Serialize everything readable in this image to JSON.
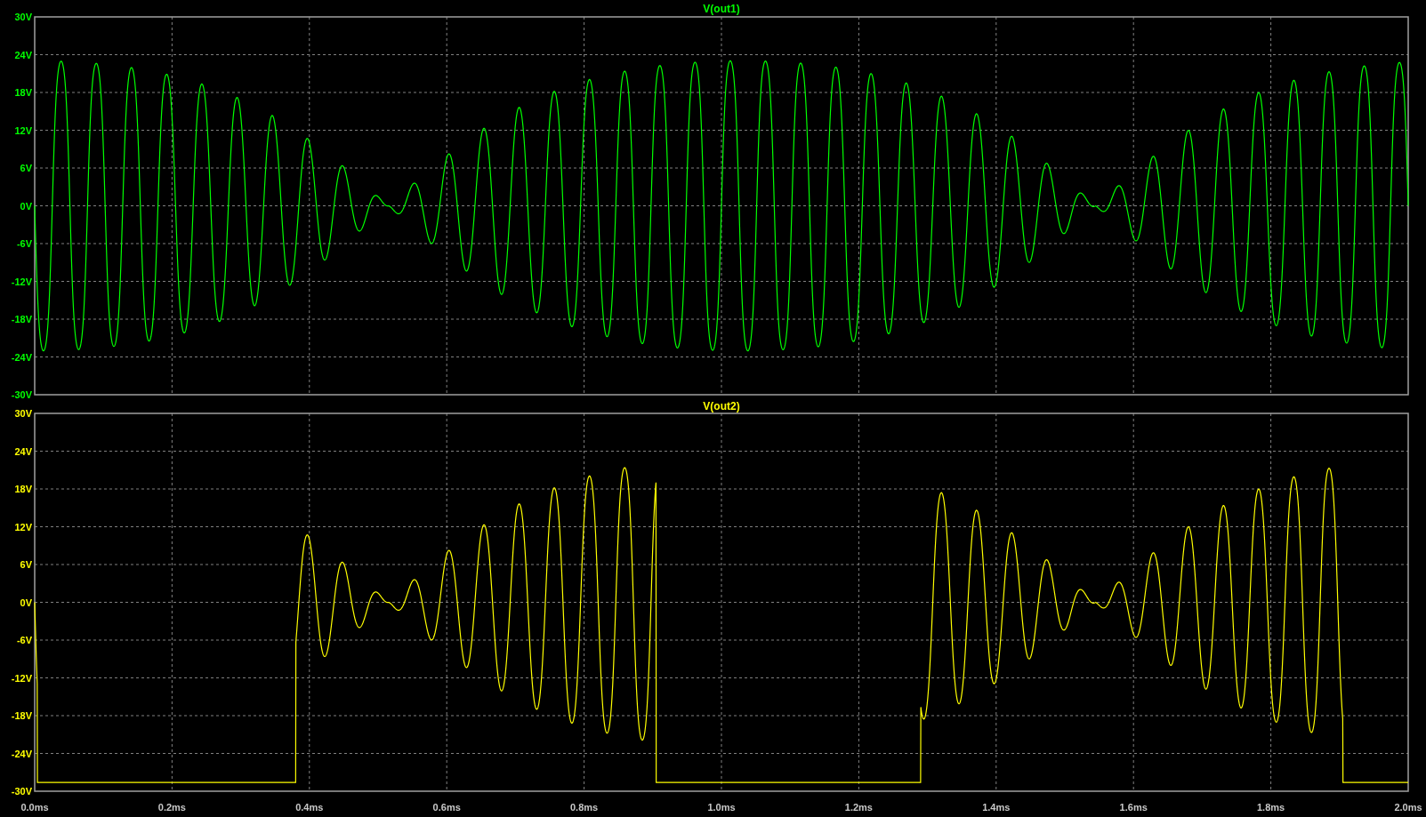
{
  "plots": [
    {
      "title": "V(out1)",
      "color": "#00ff00",
      "kind": "continuous",
      "y_ticks": [
        "30V",
        "24V",
        "18V",
        "12V",
        "6V",
        "0V",
        "-6V",
        "-12V",
        "-18V",
        "-24V",
        "-30V"
      ]
    },
    {
      "title": "V(out2)",
      "color": "#ffff00",
      "kind": "gated",
      "y_ticks": [
        "30V",
        "24V",
        "18V",
        "12V",
        "6V",
        "0V",
        "-6V",
        "-12V",
        "-18V",
        "-24V",
        "-30V"
      ]
    }
  ],
  "x_axis": {
    "ticks": [
      "0.0ms",
      "0.2ms",
      "0.4ms",
      "0.6ms",
      "0.8ms",
      "1.0ms",
      "1.2ms",
      "1.4ms",
      "1.6ms",
      "1.8ms",
      "2.0ms"
    ]
  }
}
